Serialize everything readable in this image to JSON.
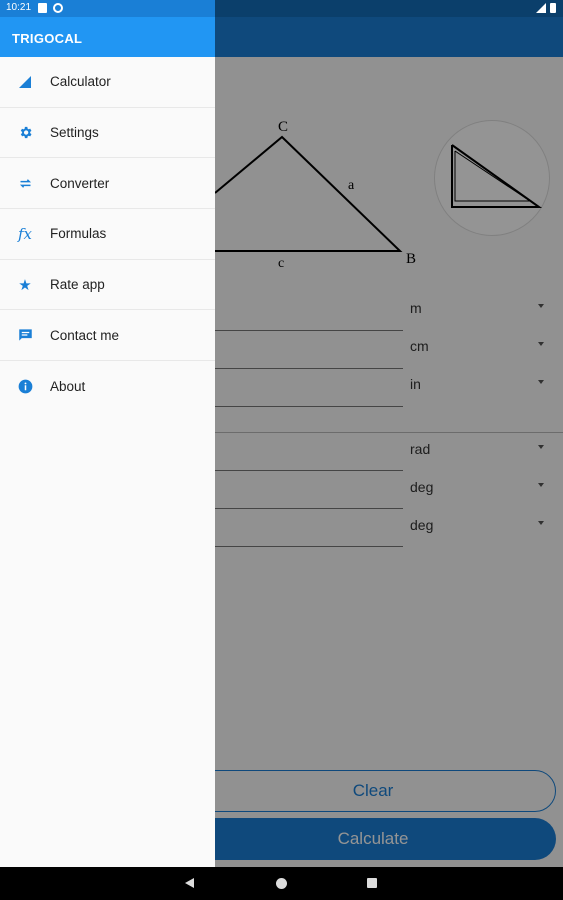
{
  "status": {
    "time": "10:21"
  },
  "drawer": {
    "title": "TRIGOCAL",
    "items": [
      {
        "label": "Calculator",
        "icon": "triangle-ruler-icon"
      },
      {
        "label": "Settings",
        "icon": "gear-icon"
      },
      {
        "label": "Converter",
        "icon": "swap-arrows-icon"
      },
      {
        "label": "Formulas",
        "icon": "function-fx-icon"
      },
      {
        "label": "Rate app",
        "icon": "star-icon"
      },
      {
        "label": "Contact me",
        "icon": "message-icon"
      },
      {
        "label": "About",
        "icon": "info-icon"
      }
    ]
  },
  "figure": {
    "vertex_c": "C",
    "vertex_b": "B",
    "side_a": "a",
    "side_c": "c"
  },
  "sides": {
    "unit1": "m",
    "unit2": "cm",
    "unit3": "in"
  },
  "angles": {
    "unit1": "rad",
    "unit2": "deg",
    "unit3": "deg"
  },
  "buttons": {
    "clear": "Clear",
    "calculate": "Calculate"
  },
  "colors": {
    "accent": "#2196f3",
    "status_bar": "#1a7fd6"
  }
}
